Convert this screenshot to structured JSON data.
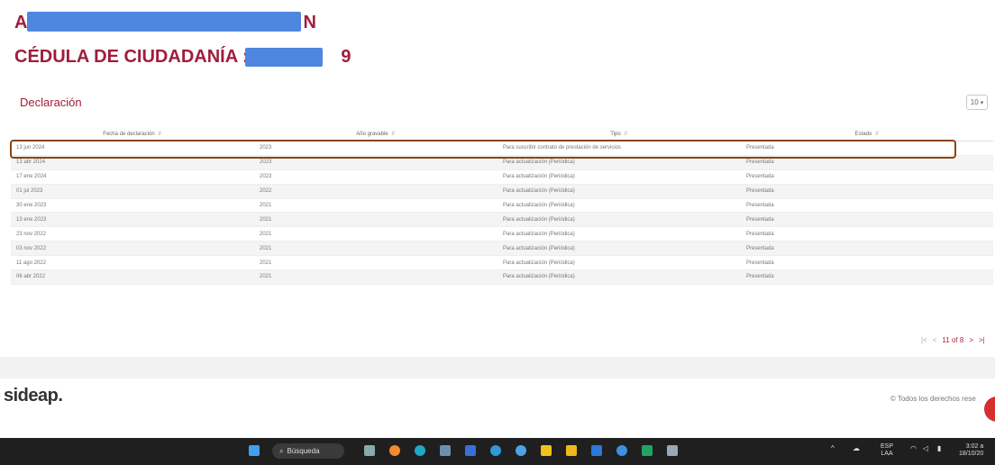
{
  "header": {
    "name_start": "A",
    "name_end": "N",
    "cedula_label": "CÉDULA DE CIUDADANÍA : 1",
    "cedula_end": "9"
  },
  "section": {
    "title": "Declaración",
    "per_page": "10"
  },
  "table": {
    "columns": [
      "Fecha de declaración",
      "Año gravable",
      "Tipo",
      "Estado"
    ],
    "rows": [
      [
        "13 jun 2024",
        "2023",
        "Para suscribir contrato de prestación de servicios",
        "Presentada"
      ],
      [
        "13 abr 2024",
        "2023",
        "Para actualización (Periódica)",
        "Presentada"
      ],
      [
        "17 ene 2024",
        "2023",
        "Para actualización (Periódica)",
        "Presentada"
      ],
      [
        "01 jul 2023",
        "2022",
        "Para actualización (Periódica)",
        "Presentada"
      ],
      [
        "30 ene 2023",
        "2021",
        "Para actualización (Periódica)",
        "Presentada"
      ],
      [
        "13 ene 2023",
        "2021",
        "Para actualización (Periódica)",
        "Presentada"
      ],
      [
        "23 nov 2022",
        "2021",
        "Para actualización (Periódica)",
        "Presentada"
      ],
      [
        "03 nov 2022",
        "2021",
        "Para actualización (Periódica)",
        "Presentada"
      ],
      [
        "11 ago 2022",
        "2021",
        "Para actualización (Periódica)",
        "Presentada"
      ],
      [
        "06 abr 2022",
        "2021",
        "Para actualización (Periódica)",
        "Presentada"
      ]
    ]
  },
  "pagination": {
    "first": "|<",
    "prev": "<",
    "info": "11 of 8",
    "next": ">",
    "last": ">|"
  },
  "footer": {
    "logo": "sideap.",
    "rights": "© Todos los derechos rese"
  },
  "taskbar": {
    "search_label": "Búsqueda",
    "lang_top": "ESP",
    "lang_bottom": "LAA",
    "time": "3:02 a",
    "date": "18/10/20"
  },
  "colors": {
    "accent": "#a01d3c",
    "highlight_border": "#8a4513",
    "redaction": "#4f86e0"
  }
}
